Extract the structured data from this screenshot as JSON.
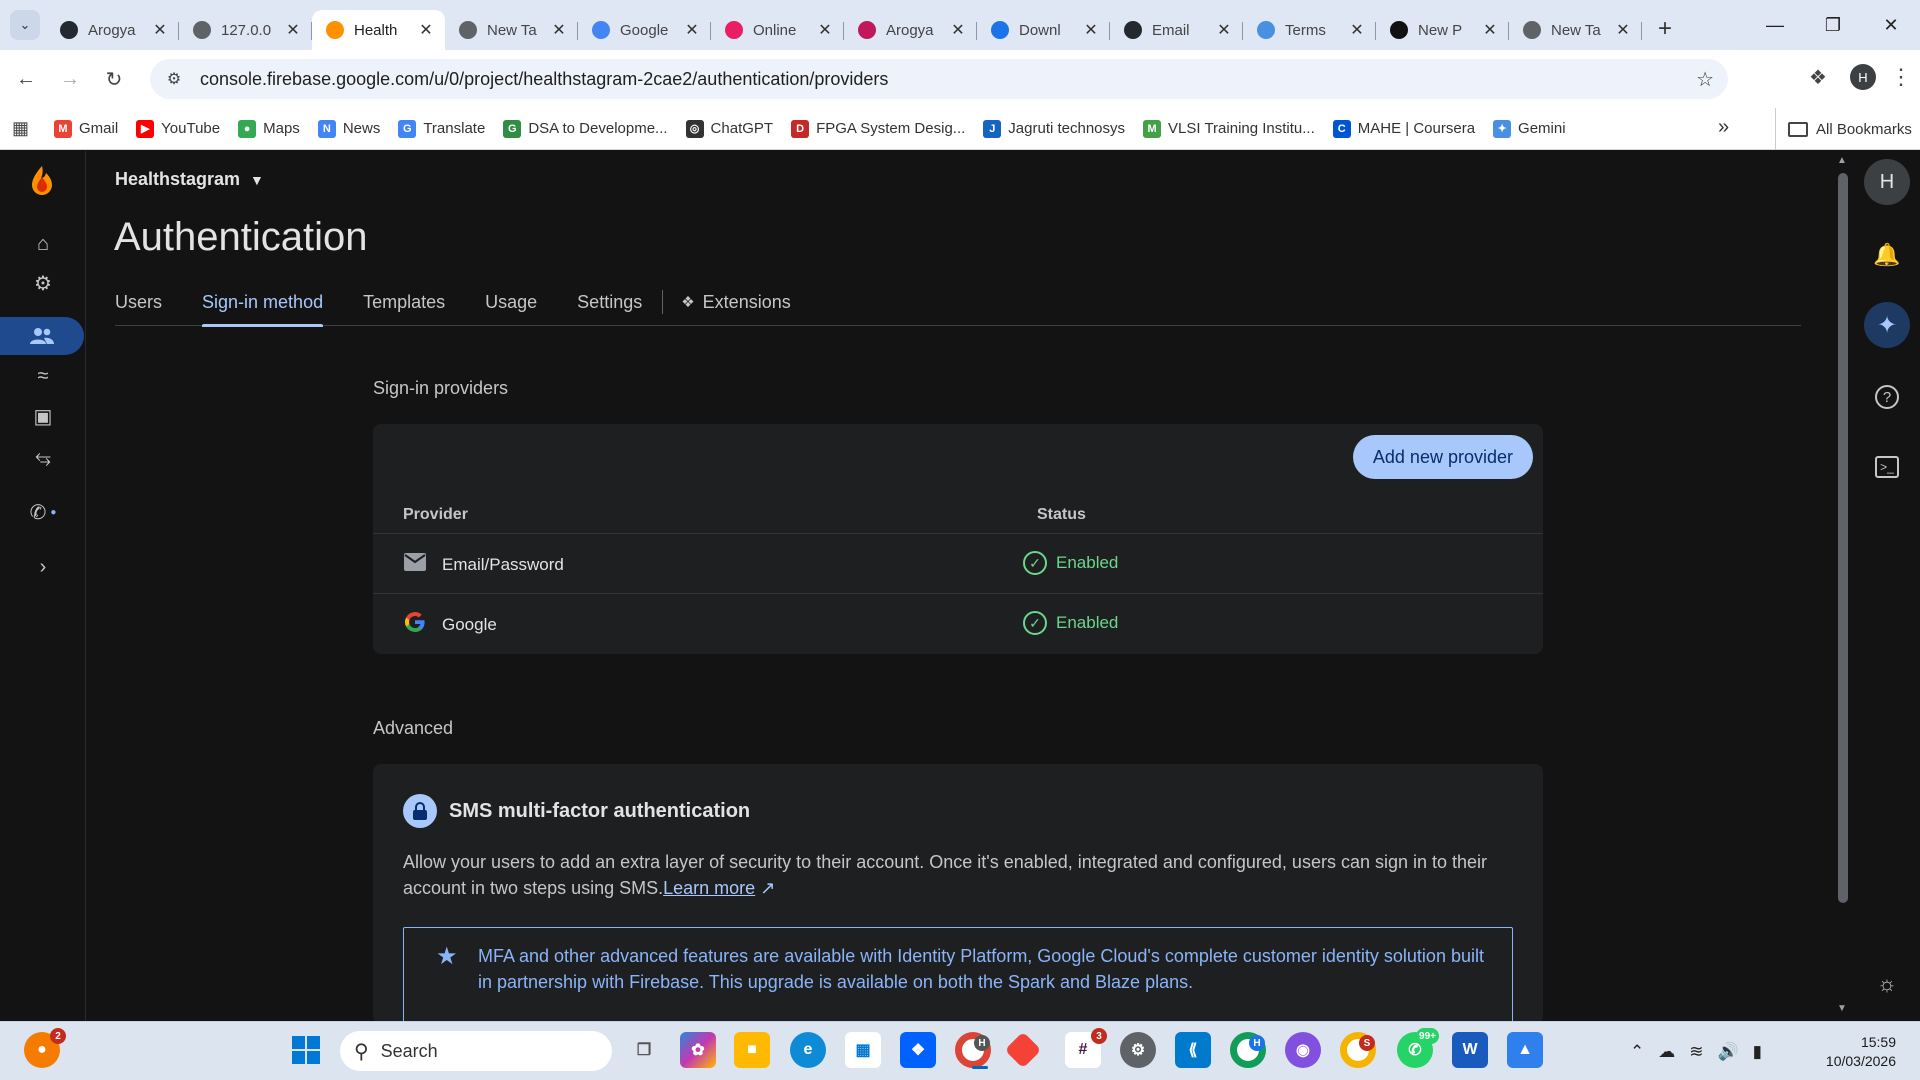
{
  "browser": {
    "tabs": [
      {
        "title": "Arogya",
        "favicon": "github-icon",
        "color": "#24292f",
        "active": false
      },
      {
        "title": "127.0.0",
        "favicon": "globe-icon",
        "color": "#5f6368",
        "active": false
      },
      {
        "title": "Health",
        "favicon": "firebase-icon",
        "color": "#ff9100",
        "active": true
      },
      {
        "title": "New Ta",
        "favicon": "chrome-icon",
        "color": "#5f6368",
        "active": false
      },
      {
        "title": "Google",
        "favicon": "google-icon",
        "color": "#4285f4",
        "active": false
      },
      {
        "title": "Online",
        "favicon": "heart-icon",
        "color": "#e91e63",
        "active": false
      },
      {
        "title": "Arogya",
        "favicon": "app-icon",
        "color": "#c2185b",
        "active": false
      },
      {
        "title": "Downl",
        "favicon": "download-icon",
        "color": "#1a73e8",
        "active": false
      },
      {
        "title": "Email",
        "favicon": "github-icon",
        "color": "#24292f",
        "active": false
      },
      {
        "title": "Terms",
        "favicon": "gemini-icon",
        "color": "#4a90e2",
        "active": false
      },
      {
        "title": "New P",
        "favicon": "app-icon",
        "color": "#111111",
        "active": false
      },
      {
        "title": "New Ta",
        "favicon": "chrome-icon",
        "color": "#5f6368",
        "active": false
      }
    ],
    "url": "console.firebase.google.com/u/0/project/healthstagram-2cae2/authentication/providers",
    "profile_initial": "H",
    "bookmarks": [
      {
        "label": "Gmail",
        "color": "#ea4335",
        "glyph": "M"
      },
      {
        "label": "YouTube",
        "color": "#ff0000",
        "glyph": "▶"
      },
      {
        "label": "Maps",
        "color": "#34a853",
        "glyph": "●"
      },
      {
        "label": "News",
        "color": "#4285f4",
        "glyph": "N"
      },
      {
        "label": "Translate",
        "color": "#4285f4",
        "glyph": "G"
      },
      {
        "label": "DSA to Developme...",
        "color": "#2f8d46",
        "glyph": "G"
      },
      {
        "label": "ChatGPT",
        "color": "#333333",
        "glyph": "◎"
      },
      {
        "label": "FPGA System Desig...",
        "color": "#c62828",
        "glyph": "D"
      },
      {
        "label": "Jagruti technosys",
        "color": "#1565c0",
        "glyph": "J"
      },
      {
        "label": "VLSI Training Institu...",
        "color": "#43a047",
        "glyph": "M"
      },
      {
        "label": "MAHE | Coursera",
        "color": "#0056d2",
        "glyph": "C"
      },
      {
        "label": "Gemini",
        "color": "#4a90e2",
        "glyph": "✦"
      }
    ],
    "all_bookmarks_label": "All Bookmarks"
  },
  "console": {
    "project_name": "Healthstagram",
    "page_title": "Authentication",
    "tabs": [
      {
        "label": "Users",
        "active": false
      },
      {
        "label": "Sign-in method",
        "active": true
      },
      {
        "label": "Templates",
        "active": false
      },
      {
        "label": "Usage",
        "active": false
      },
      {
        "label": "Settings",
        "active": false
      },
      {
        "label": "Extensions",
        "active": false
      }
    ],
    "providers_section": {
      "heading": "Sign-in providers",
      "add_button": "Add new provider",
      "col_provider": "Provider",
      "col_status": "Status",
      "rows": [
        {
          "provider": "Email/Password",
          "icon": "email-icon",
          "status": "Enabled"
        },
        {
          "provider": "Google",
          "icon": "google-icon",
          "status": "Enabled"
        }
      ]
    },
    "advanced": {
      "heading": "Advanced",
      "mfa_title": "SMS multi-factor authentication",
      "mfa_desc": "Allow your users to add an extra layer of security to their account. Once it's enabled, integrated and configured, users can sign in to their account in two steps using SMS.",
      "learn_more": "Learn more",
      "notice": "MFA and other advanced features are available with Identity Platform, Google Cloud's complete customer identity solution built in partnership with Firebase. This upgrade is available on both the Spark and Blaze plans."
    },
    "right_rail_avatar": "H",
    "accent_color": "#a8c7fa",
    "success_color": "#6dd58c"
  },
  "taskbar": {
    "search_placeholder": "Search",
    "time": "15:59",
    "date": "10/03/2026",
    "badges": {
      "system": "2",
      "slack": "3",
      "chrome_h": "H",
      "chrome_h2": "H",
      "chrome_s": "S",
      "whatsapp": "99+"
    }
  }
}
